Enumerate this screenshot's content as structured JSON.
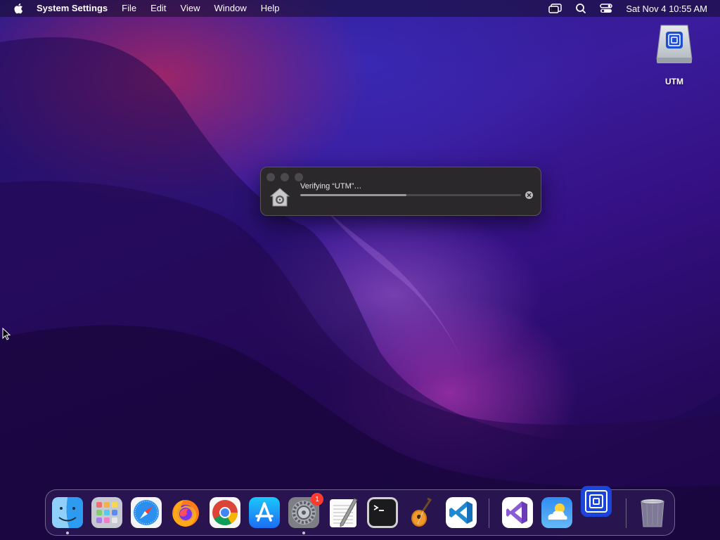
{
  "menubar": {
    "app_name": "System Settings",
    "items": [
      "File",
      "Edit",
      "View",
      "Window",
      "Help"
    ],
    "clock": "Sat Nov 4  10:55 AM"
  },
  "desktop": {
    "icons": [
      {
        "label": "UTM",
        "icon": "disk-volume-icon"
      }
    ]
  },
  "verify_dialog": {
    "title": "Verifying “UTM”…",
    "progress": 0.48
  },
  "dock": {
    "apps": [
      {
        "name": "Finder",
        "running": true
      },
      {
        "name": "Launchpad",
        "running": false
      },
      {
        "name": "Safari",
        "running": false
      },
      {
        "name": "Firefox",
        "running": false
      },
      {
        "name": "Google Chrome",
        "running": false
      },
      {
        "name": "App Store",
        "running": false
      },
      {
        "name": "System Settings",
        "running": true,
        "badge": "1"
      },
      {
        "name": "TextEdit",
        "running": false
      },
      {
        "name": "Terminal",
        "running": false
      },
      {
        "name": "GarageBand",
        "running": false
      },
      {
        "name": "Visual Studio Code",
        "running": false
      },
      {
        "name": "Visual Studio",
        "running": false
      },
      {
        "name": "Weather",
        "running": false
      },
      {
        "name": "UTM",
        "running": false
      },
      {
        "name": "Trash",
        "running": false
      }
    ]
  },
  "colors": {
    "badge": "#ff3b30",
    "wallpaper": "#341083"
  }
}
